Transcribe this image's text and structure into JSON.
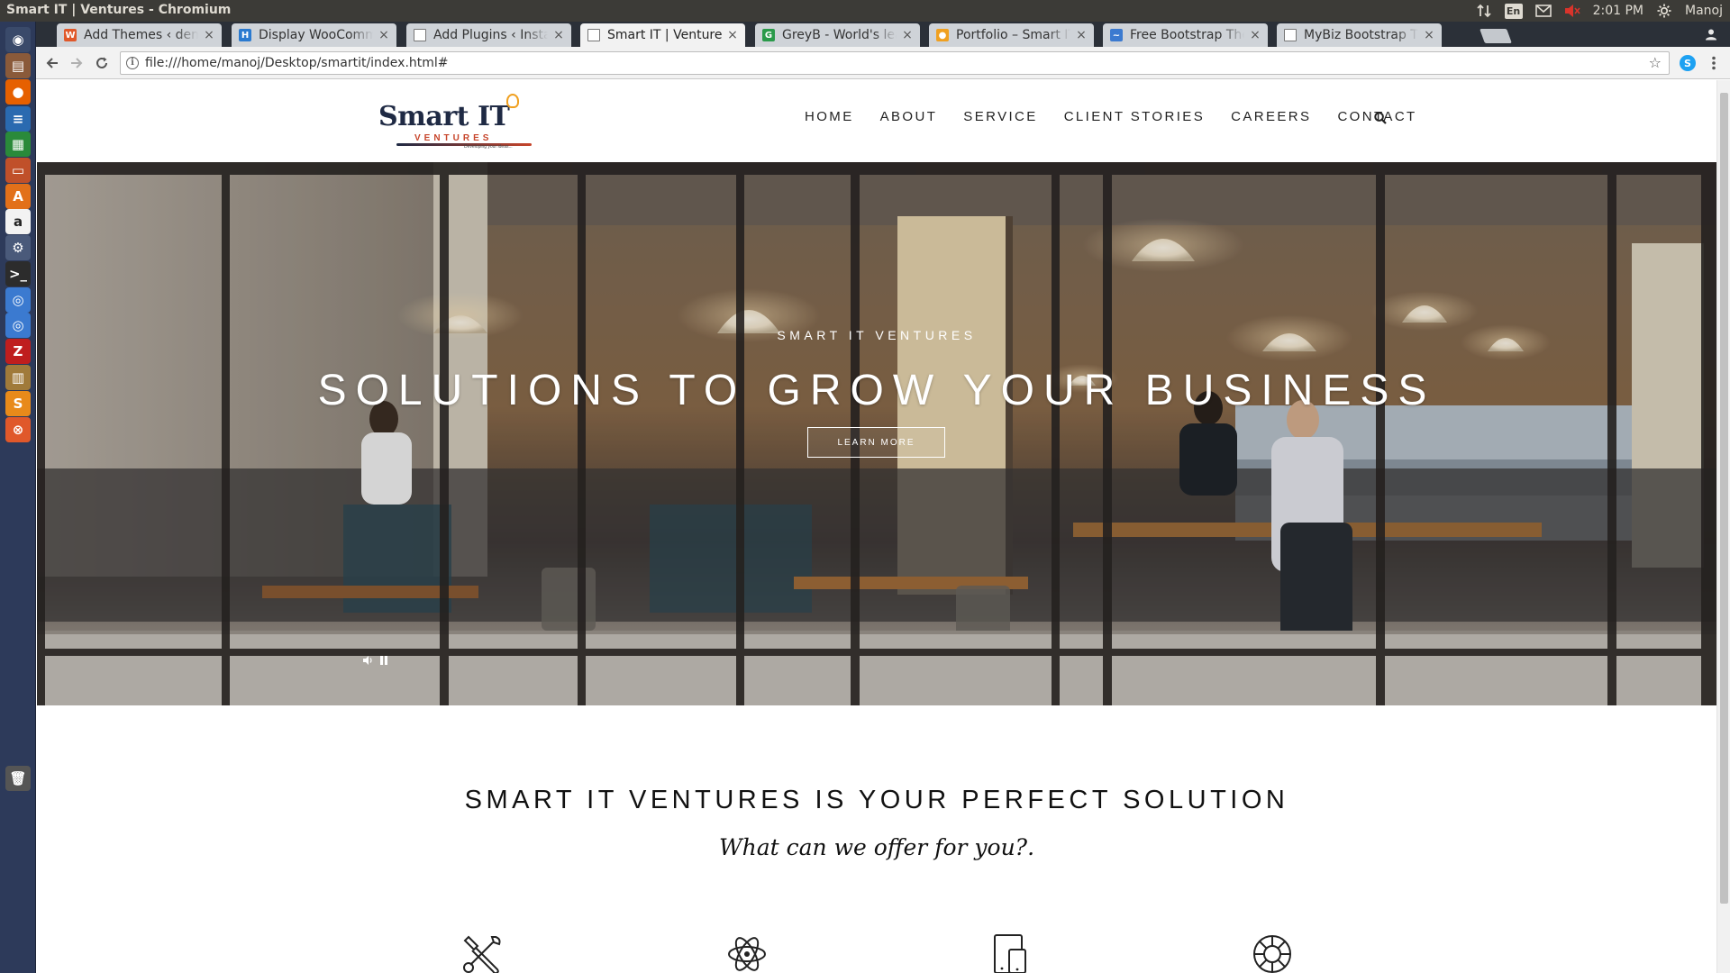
{
  "os": {
    "window_title": "Smart IT | Ventures - Chromium",
    "clock": "2:01 PM",
    "user": "Manoj",
    "lang": "En"
  },
  "launcher": {
    "apps": [
      {
        "name": "dash-icon",
        "glyph": "◉",
        "color": "#3a4a6a"
      },
      {
        "name": "files-icon",
        "glyph": "▤",
        "color": "#8a5a3a"
      },
      {
        "name": "firefox-icon",
        "glyph": "●",
        "color": "#e66000"
      },
      {
        "name": "writer-icon",
        "glyph": "≡",
        "color": "#2a6ab0"
      },
      {
        "name": "calc-icon",
        "glyph": "▦",
        "color": "#2a8a3a"
      },
      {
        "name": "impress-icon",
        "glyph": "▭",
        "color": "#c0502a"
      },
      {
        "name": "software-center-icon",
        "glyph": "A",
        "color": "#e2701a"
      },
      {
        "name": "amazon-icon",
        "glyph": "a",
        "color": "#f2f2f2"
      },
      {
        "name": "settings-icon",
        "glyph": "⚙",
        "color": "#4a5a7a"
      },
      {
        "name": "terminal-icon",
        "glyph": ">_",
        "color": "#2c2c2c"
      },
      {
        "name": "chromium-icon",
        "glyph": "◎",
        "color": "#3b7ad0"
      },
      {
        "name": "chromium-icon-2",
        "glyph": "◎",
        "color": "#3b7ad0"
      },
      {
        "name": "filezilla-icon",
        "glyph": "Z",
        "color": "#bf1e1e"
      },
      {
        "name": "archive-icon",
        "glyph": "▥",
        "color": "#a07a3a"
      },
      {
        "name": "sublime-icon",
        "glyph": "S",
        "color": "#e88a1a"
      },
      {
        "name": "postman-icon",
        "glyph": "⊗",
        "color": "#e0582a"
      },
      {
        "name": "trash-icon",
        "glyph": "🗑",
        "color": "#555555"
      }
    ]
  },
  "tabs": [
    {
      "title": "Add Themes ‹ demo",
      "fav_color": "#e0582a",
      "fav_glyph": "W",
      "active": false
    },
    {
      "title": "Display WooComm",
      "fav_color": "#2a7ad0",
      "fav_glyph": "H",
      "active": false
    },
    {
      "title": "Add Plugins ‹ Instan",
      "fav_color": "#ffffff",
      "fav_glyph": "",
      "active": false
    },
    {
      "title": "Smart IT | Ventures",
      "fav_color": "#ffffff",
      "fav_glyph": "",
      "active": true
    },
    {
      "title": "GreyB - World's lea",
      "fav_color": "#2a9a4a",
      "fav_glyph": "G",
      "active": false
    },
    {
      "title": "Portfolio – Smart IT",
      "fav_color": "#f0a020",
      "fav_glyph": "●",
      "active": false
    },
    {
      "title": "Free Bootstrap The",
      "fav_color": "#3b7ad0",
      "fav_glyph": "~",
      "active": false
    },
    {
      "title": "MyBiz Bootstrap Th",
      "fav_color": "#ffffff",
      "fav_glyph": "",
      "active": false
    }
  ],
  "toolbar": {
    "url": "file:///home/manoj/Desktop/smartit/index.html#"
  },
  "site": {
    "logo": {
      "brand": "Smart IT",
      "sub": "VENTURES",
      "tagline": "Developing your ideas..."
    },
    "nav": [
      "HOME",
      "ABOUT",
      "SERVICE",
      "CLIENT STORIES",
      "CAREERS",
      "CONTACT"
    ],
    "hero": {
      "eyebrow": "SMART IT VENTURES",
      "headline": "SOLUTIONS TO GROW YOUR BUSINESS",
      "cta": "LEARN MORE"
    },
    "intro": {
      "title": "SMART IT VENTURES IS YOUR PERFECT SOLUTION",
      "subtitle": "What can we offer for you?."
    },
    "features": [
      {
        "icon": "tools-icon"
      },
      {
        "icon": "atom-icon"
      },
      {
        "icon": "devices-icon"
      },
      {
        "icon": "lifebuoy-icon"
      }
    ]
  }
}
